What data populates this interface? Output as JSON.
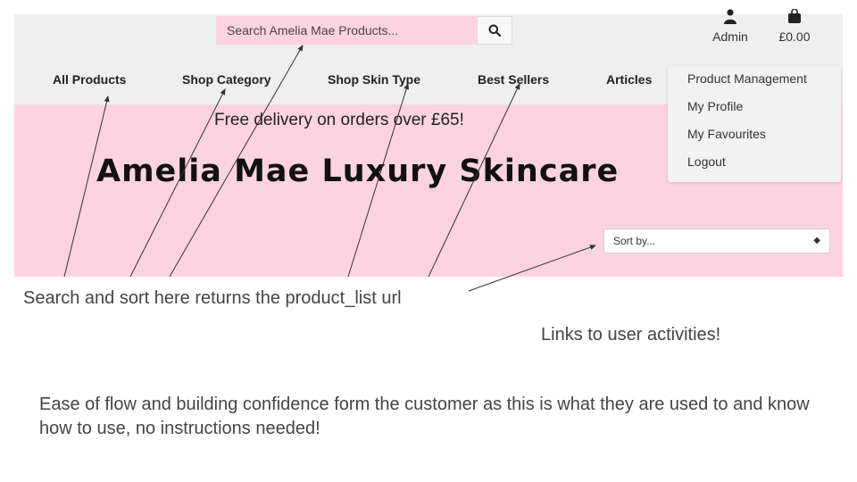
{
  "header": {
    "search": {
      "placeholder": "Search Amelia Mae Products..."
    },
    "actions": [
      {
        "label": "Admin",
        "icon": "user-icon"
      },
      {
        "label": "£0.00",
        "icon": "shopping-bag-icon"
      }
    ]
  },
  "nav": {
    "items": [
      {
        "label": "All Products"
      },
      {
        "label": "Shop Category"
      },
      {
        "label": "Shop Skin Type"
      },
      {
        "label": "Best Sellers"
      },
      {
        "label": "Articles"
      }
    ]
  },
  "hero": {
    "delivery_text": "Free delivery on orders over £65!",
    "brand_title": "Amelia Mae Luxury Skincare",
    "sort": {
      "selected": "Sort by..."
    }
  },
  "account_menu": {
    "items": [
      {
        "label": "Product Management"
      },
      {
        "label": "My Profile"
      },
      {
        "label": "My Favourites"
      },
      {
        "label": "Logout"
      }
    ]
  },
  "annotations": {
    "search_note": "Search and sort here returns the product_list url",
    "links_note": "Links to user activities!",
    "flow_note": "Ease of flow and building confidence form the customer as this is what they are used to and know how to use, no instructions needed!"
  },
  "colors": {
    "pink": "#fdd3e2",
    "header_gray": "#efefef",
    "annotation_text": "#444444"
  }
}
